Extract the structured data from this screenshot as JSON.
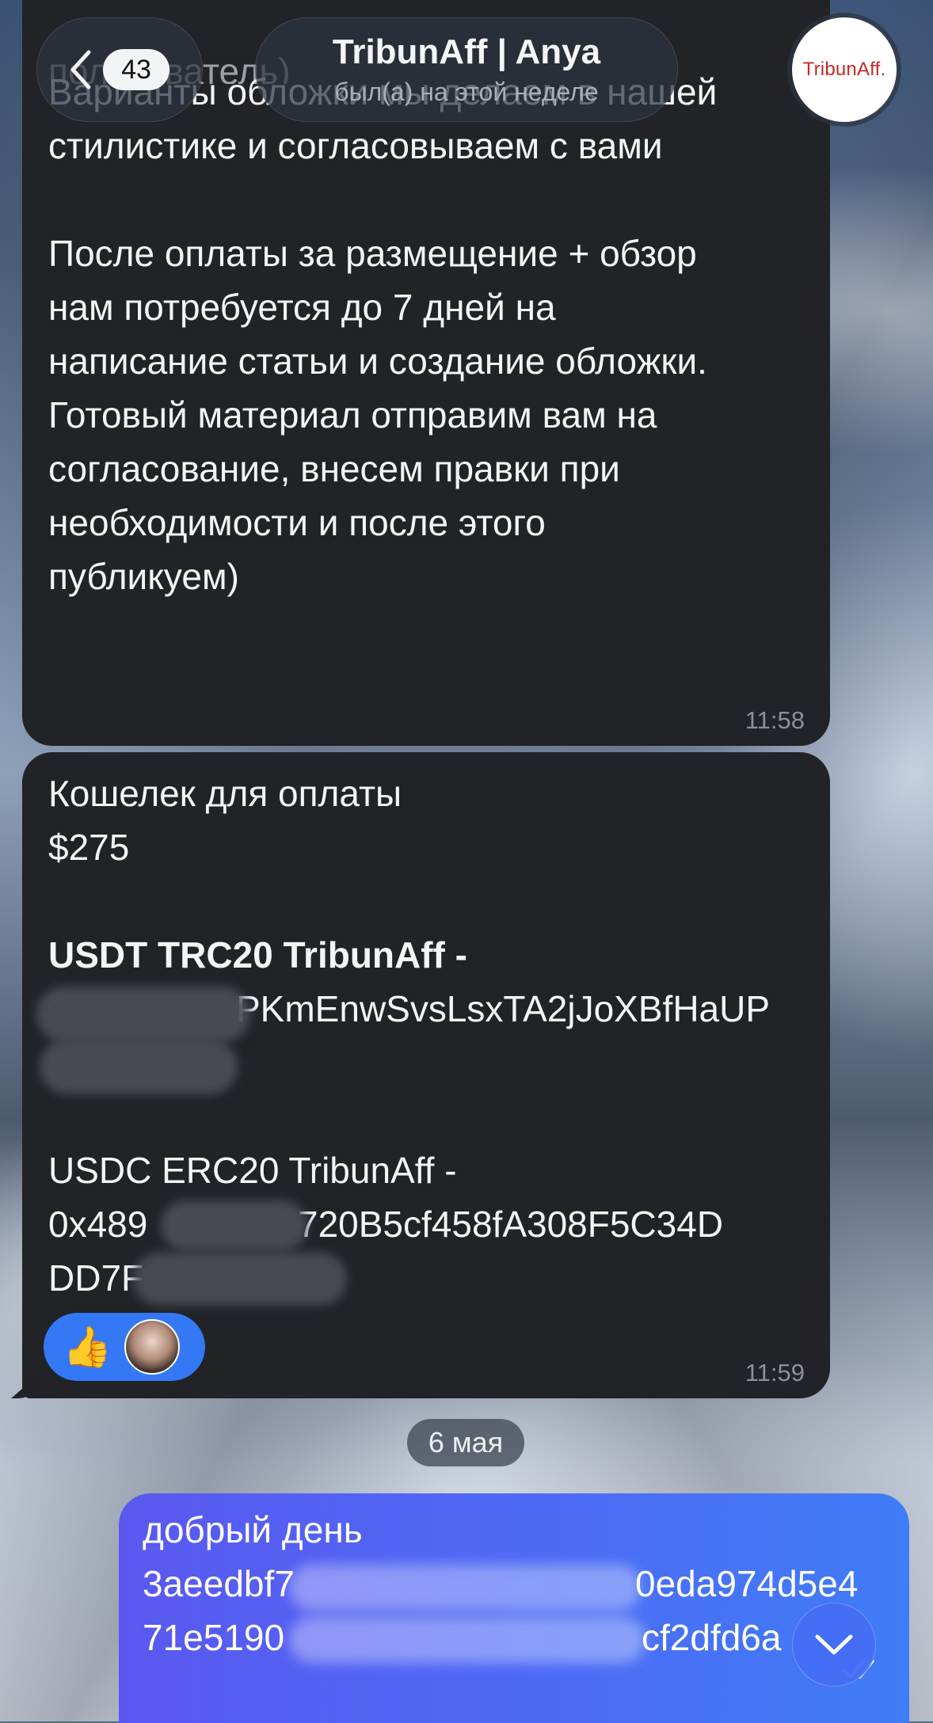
{
  "header": {
    "unread_count": "43",
    "title": "TribunAff | Anya",
    "status": "был(а) на этой неделе",
    "avatar_text": "TribunAff."
  },
  "messages": [
    {
      "partial_top": "пользователь)",
      "text": "Варианты обложки мы делаем в нашей\nстилистике и согласовываем с вами\n\nПосле оплаты за размещение + обзор\nнам потребуется до 7 дней на\nнаписание статьи и создание обложки.\nГотовый материал отправим вам на\nсогласование, внесем правки при\nнеобходимости и после этого\nпубликуем)",
      "time": "11:58"
    },
    {
      "line1": "Кошелек для оплаты",
      "line2": "$275",
      "usdt_label": "USDT TRC20 TribunAff -",
      "usdt_address_visible": "PKmEnwSvsLsxTA2jJoXBfHaUP",
      "usdc_label": "USDC ERC20 TribunAff -",
      "usdc_address_line1": "0x489",
      "usdc_address_line1b": "720B5cf458fA308F5C34D",
      "usdc_address_line2": "DD7F",
      "reaction_emoji": "👍",
      "time": "11:59"
    }
  ],
  "date_separator": "6 мая",
  "outgoing": {
    "line1": "добрый день",
    "line2a": "3aeedbf7",
    "line2b": "0eda974d5e4",
    "line3a": "71e5190",
    "line3b": "cf2dfd6a"
  },
  "icons": {
    "back": "chevron-left-icon",
    "scroll_down": "chevron-down-icon",
    "read": "double-check-icon"
  }
}
